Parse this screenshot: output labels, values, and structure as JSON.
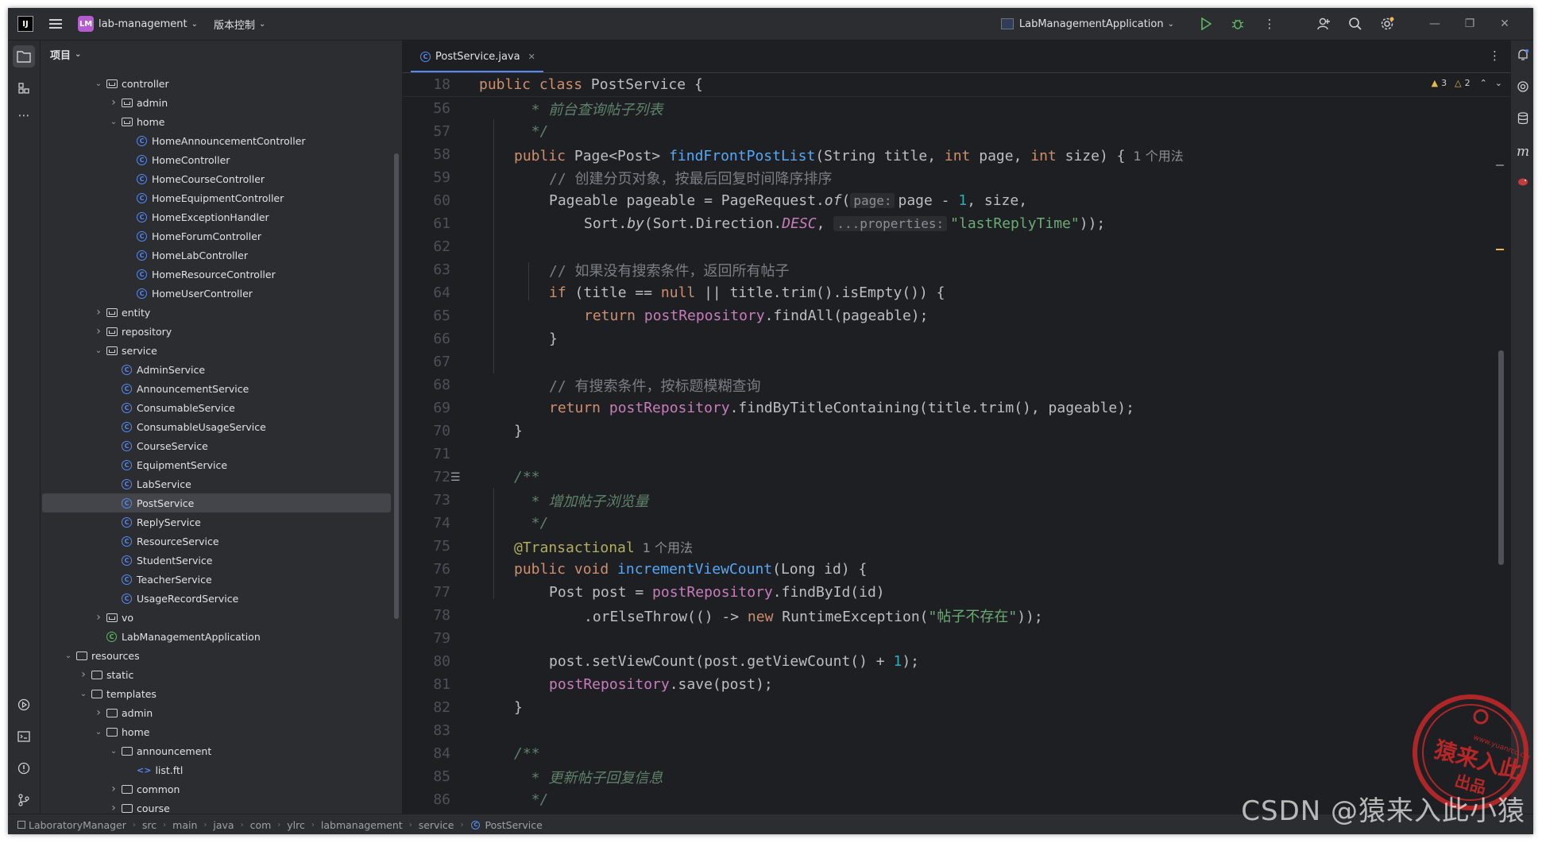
{
  "titlebar": {
    "app_icon": "intellij-logo",
    "project_badge": "LM",
    "project_name": "lab-management",
    "vcs_label": "版本控制",
    "run_config": "LabManagementApplication",
    "icons": [
      "run-icon",
      "debug-icon",
      "more-icon",
      "add-user-icon",
      "search-icon",
      "settings-icon"
    ],
    "window_controls": [
      "minimize",
      "restore",
      "close"
    ]
  },
  "project_panel": {
    "title": "项目",
    "tree": [
      {
        "label": "controller",
        "type": "pkg",
        "indent": 3,
        "arrow": "open"
      },
      {
        "label": "admin",
        "type": "pkg",
        "indent": 4,
        "arrow": "closed"
      },
      {
        "label": "home",
        "type": "pkg",
        "indent": 4,
        "arrow": "open"
      },
      {
        "label": "HomeAnnouncementController",
        "type": "class",
        "indent": 5
      },
      {
        "label": "HomeController",
        "type": "class",
        "indent": 5
      },
      {
        "label": "HomeCourseController",
        "type": "class",
        "indent": 5
      },
      {
        "label": "HomeEquipmentController",
        "type": "class",
        "indent": 5
      },
      {
        "label": "HomeExceptionHandler",
        "type": "class",
        "indent": 5
      },
      {
        "label": "HomeForumController",
        "type": "class",
        "indent": 5
      },
      {
        "label": "HomeLabController",
        "type": "class",
        "indent": 5
      },
      {
        "label": "HomeResourceController",
        "type": "class",
        "indent": 5
      },
      {
        "label": "HomeUserController",
        "type": "class",
        "indent": 5
      },
      {
        "label": "entity",
        "type": "pkg",
        "indent": 3,
        "arrow": "closed"
      },
      {
        "label": "repository",
        "type": "pkg",
        "indent": 3,
        "arrow": "closed"
      },
      {
        "label": "service",
        "type": "pkg",
        "indent": 3,
        "arrow": "open"
      },
      {
        "label": "AdminService",
        "type": "class",
        "indent": 4
      },
      {
        "label": "AnnouncementService",
        "type": "class",
        "indent": 4
      },
      {
        "label": "ConsumableService",
        "type": "class",
        "indent": 4
      },
      {
        "label": "ConsumableUsageService",
        "type": "class",
        "indent": 4
      },
      {
        "label": "CourseService",
        "type": "class",
        "indent": 4
      },
      {
        "label": "EquipmentService",
        "type": "class",
        "indent": 4
      },
      {
        "label": "LabService",
        "type": "class",
        "indent": 4
      },
      {
        "label": "PostService",
        "type": "class",
        "indent": 4,
        "selected": true
      },
      {
        "label": "ReplyService",
        "type": "class",
        "indent": 4
      },
      {
        "label": "ResourceService",
        "type": "class",
        "indent": 4
      },
      {
        "label": "StudentService",
        "type": "class",
        "indent": 4
      },
      {
        "label": "TeacherService",
        "type": "class",
        "indent": 4
      },
      {
        "label": "UsageRecordService",
        "type": "class",
        "indent": 4
      },
      {
        "label": "vo",
        "type": "pkg",
        "indent": 3,
        "arrow": "closed"
      },
      {
        "label": "LabManagementApplication",
        "type": "app",
        "indent": 3
      },
      {
        "label": "resources",
        "type": "folder",
        "indent": 1,
        "arrow": "open"
      },
      {
        "label": "static",
        "type": "folder",
        "indent": 2,
        "arrow": "closed"
      },
      {
        "label": "templates",
        "type": "folder",
        "indent": 2,
        "arrow": "open"
      },
      {
        "label": "admin",
        "type": "folder",
        "indent": 3,
        "arrow": "closed"
      },
      {
        "label": "home",
        "type": "folder",
        "indent": 3,
        "arrow": "open"
      },
      {
        "label": "announcement",
        "type": "folder",
        "indent": 4,
        "arrow": "open"
      },
      {
        "label": "list.ftl",
        "type": "ftl",
        "indent": 5
      },
      {
        "label": "common",
        "type": "folder",
        "indent": 4,
        "arrow": "closed"
      },
      {
        "label": "course",
        "type": "folder",
        "indent": 4,
        "arrow": "closed"
      }
    ]
  },
  "editor": {
    "tab_label": "PostService.java",
    "inspections": {
      "warnings": "3",
      "weak_warnings": "2"
    },
    "lines": [
      {
        "n": "18",
        "sticky": true,
        "indent": 0,
        "tokens": [
          [
            "kw",
            "public class "
          ],
          [
            "t",
            "PostService"
          ],
          [
            "t",
            " {"
          ]
        ]
      },
      {
        "n": "56",
        "indent": 1,
        "tokens": [
          [
            "doc",
            "  * 前台查询帖子列表"
          ]
        ]
      },
      {
        "n": "57",
        "indent": 1,
        "tokens": [
          [
            "doc",
            "  */"
          ]
        ]
      },
      {
        "n": "58",
        "indent": 1,
        "tokens": [
          [
            "kw",
            "public "
          ],
          [
            "t",
            "Page<Post> "
          ],
          [
            "fn",
            "findFrontPostList"
          ],
          [
            "t",
            "(String title, "
          ],
          [
            "kw",
            "int "
          ],
          [
            "t",
            "page, "
          ],
          [
            "kw",
            "int "
          ],
          [
            "t",
            "size) {"
          ],
          [
            "usage",
            "1 个用法"
          ]
        ]
      },
      {
        "n": "59",
        "indent": 2,
        "tokens": [
          [
            "cmt",
            "// 创建分页对象，按最后回复时间降序排序"
          ]
        ]
      },
      {
        "n": "60",
        "indent": 2,
        "tokens": [
          [
            "t",
            "Pageable pageable = PageRequest."
          ],
          [
            "ital",
            "of"
          ],
          [
            "t",
            "("
          ],
          [
            "hint",
            "page:"
          ],
          [
            "t",
            "page - "
          ],
          [
            "num",
            "1"
          ],
          [
            "t",
            ", size,"
          ]
        ]
      },
      {
        "n": "61",
        "indent": 3,
        "tokens": [
          [
            "t",
            "Sort."
          ],
          [
            "ital",
            "by"
          ],
          [
            "t",
            "(Sort.Direction."
          ],
          [
            "fieldi",
            "DESC"
          ],
          [
            "t",
            ", "
          ],
          [
            "hint",
            "...properties:"
          ],
          [
            "str",
            "\"lastReplyTime\""
          ],
          [
            "t",
            "));"
          ]
        ]
      },
      {
        "n": "62",
        "indent": 0,
        "tokens": []
      },
      {
        "n": "63",
        "indent": 2,
        "tokens": [
          [
            "cmt",
            "// 如果没有搜索条件，返回所有帖子"
          ]
        ]
      },
      {
        "n": "64",
        "indent": 2,
        "tokens": [
          [
            "kw",
            "if "
          ],
          [
            "t",
            "(title == "
          ],
          [
            "kw",
            "null "
          ],
          [
            "t",
            "|| title.trim().isEmpty()) {"
          ]
        ]
      },
      {
        "n": "65",
        "indent": 3,
        "tokens": [
          [
            "kw",
            "return "
          ],
          [
            "field",
            "postRepository"
          ],
          [
            "t",
            ".findAll(pageable);"
          ]
        ]
      },
      {
        "n": "66",
        "indent": 2,
        "tokens": [
          [
            "t",
            "}"
          ]
        ]
      },
      {
        "n": "67",
        "indent": 0,
        "tokens": []
      },
      {
        "n": "68",
        "indent": 2,
        "tokens": [
          [
            "cmt",
            "// 有搜索条件，按标题模糊查询"
          ]
        ]
      },
      {
        "n": "69",
        "indent": 2,
        "tokens": [
          [
            "kw",
            "return "
          ],
          [
            "field",
            "postRepository"
          ],
          [
            "t",
            ".findByTitleContaining(title.trim(), pageable);"
          ]
        ]
      },
      {
        "n": "70",
        "indent": 1,
        "tokens": [
          [
            "t",
            "}"
          ]
        ]
      },
      {
        "n": "71",
        "indent": 0,
        "tokens": []
      },
      {
        "n": "72",
        "indent": 1,
        "gutter": "doc-render-icon",
        "tokens": [
          [
            "doc",
            "/**"
          ]
        ]
      },
      {
        "n": "73",
        "indent": 1,
        "tokens": [
          [
            "doc",
            "  * 增加帖子浏览量"
          ]
        ]
      },
      {
        "n": "74",
        "indent": 1,
        "tokens": [
          [
            "doc",
            "  */"
          ]
        ]
      },
      {
        "n": "75",
        "indent": 1,
        "tokens": [
          [
            "ann",
            "@Transactional"
          ],
          [
            "usage",
            "1 个用法"
          ]
        ]
      },
      {
        "n": "76",
        "indent": 1,
        "tokens": [
          [
            "kw",
            "public void "
          ],
          [
            "fn",
            "incrementViewCount"
          ],
          [
            "t",
            "(Long id) {"
          ]
        ]
      },
      {
        "n": "77",
        "indent": 2,
        "tokens": [
          [
            "t",
            "Post post = "
          ],
          [
            "field",
            "postRepository"
          ],
          [
            "t",
            ".findById(id)"
          ]
        ]
      },
      {
        "n": "78",
        "indent": 3,
        "tokens": [
          [
            "t",
            ".orElseThrow(() -> "
          ],
          [
            "kw",
            "new "
          ],
          [
            "t",
            "RuntimeException("
          ],
          [
            "str",
            "\"帖子不存在\""
          ],
          [
            "t",
            "));"
          ]
        ]
      },
      {
        "n": "79",
        "indent": 0,
        "tokens": []
      },
      {
        "n": "80",
        "indent": 2,
        "tokens": [
          [
            "t",
            "post.setViewCount(post.getViewCount() + "
          ],
          [
            "num",
            "1"
          ],
          [
            "t",
            ");"
          ]
        ]
      },
      {
        "n": "81",
        "indent": 2,
        "tokens": [
          [
            "field",
            "postRepository"
          ],
          [
            "t",
            ".save(post);"
          ]
        ]
      },
      {
        "n": "82",
        "indent": 1,
        "tokens": [
          [
            "t",
            "}"
          ]
        ]
      },
      {
        "n": "83",
        "indent": 0,
        "tokens": []
      },
      {
        "n": "84",
        "indent": 1,
        "tokens": [
          [
            "doc",
            "/**"
          ]
        ]
      },
      {
        "n": "85",
        "indent": 1,
        "tokens": [
          [
            "doc",
            "  * 更新帖子回复信息"
          ]
        ]
      },
      {
        "n": "86",
        "indent": 1,
        "tokens": [
          [
            "doc",
            "  */"
          ]
        ]
      }
    ]
  },
  "statusbar": {
    "breadcrumb": [
      "LaboratoryManager",
      "src",
      "main",
      "java",
      "com",
      "ylrc",
      "labmanagement",
      "service",
      "PostService"
    ]
  },
  "watermark": {
    "csdn": "CSDN @猿来入此小猿",
    "seal_top": "www.yuanrcc.com",
    "seal_main": "猿来入此",
    "seal_bottom": "出品"
  },
  "colors": {
    "accent": "#548af7",
    "selection": "#43454a",
    "keyword": "#cf8e6d",
    "method": "#56a8f5",
    "field": "#c77dbb",
    "string": "#6aab73"
  }
}
